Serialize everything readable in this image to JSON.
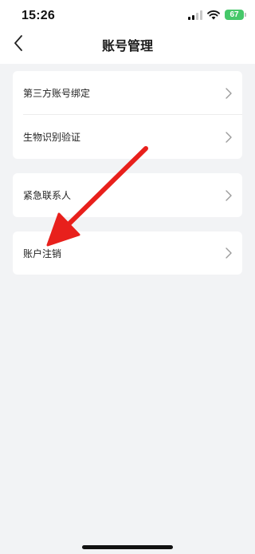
{
  "status_bar": {
    "time": "15:26",
    "battery": "67"
  },
  "nav": {
    "title": "账号管理"
  },
  "groups": [
    {
      "items": [
        {
          "label": "第三方账号绑定"
        },
        {
          "label": "生物识别验证"
        }
      ]
    },
    {
      "items": [
        {
          "label": "紧急联系人"
        }
      ]
    },
    {
      "items": [
        {
          "label": "账户注销"
        }
      ]
    }
  ],
  "icons": {
    "back": "chevron-left-icon",
    "row_chevron": "chevron-right-icon",
    "signal": "cellular-signal-icon",
    "wifi": "wifi-icon",
    "battery": "battery-icon",
    "annotation": "red-arrow-icon"
  },
  "colors": {
    "background": "#f2f3f5",
    "card": "#ffffff",
    "battery": "#46c86a",
    "annotation_arrow": "#e8201c"
  }
}
